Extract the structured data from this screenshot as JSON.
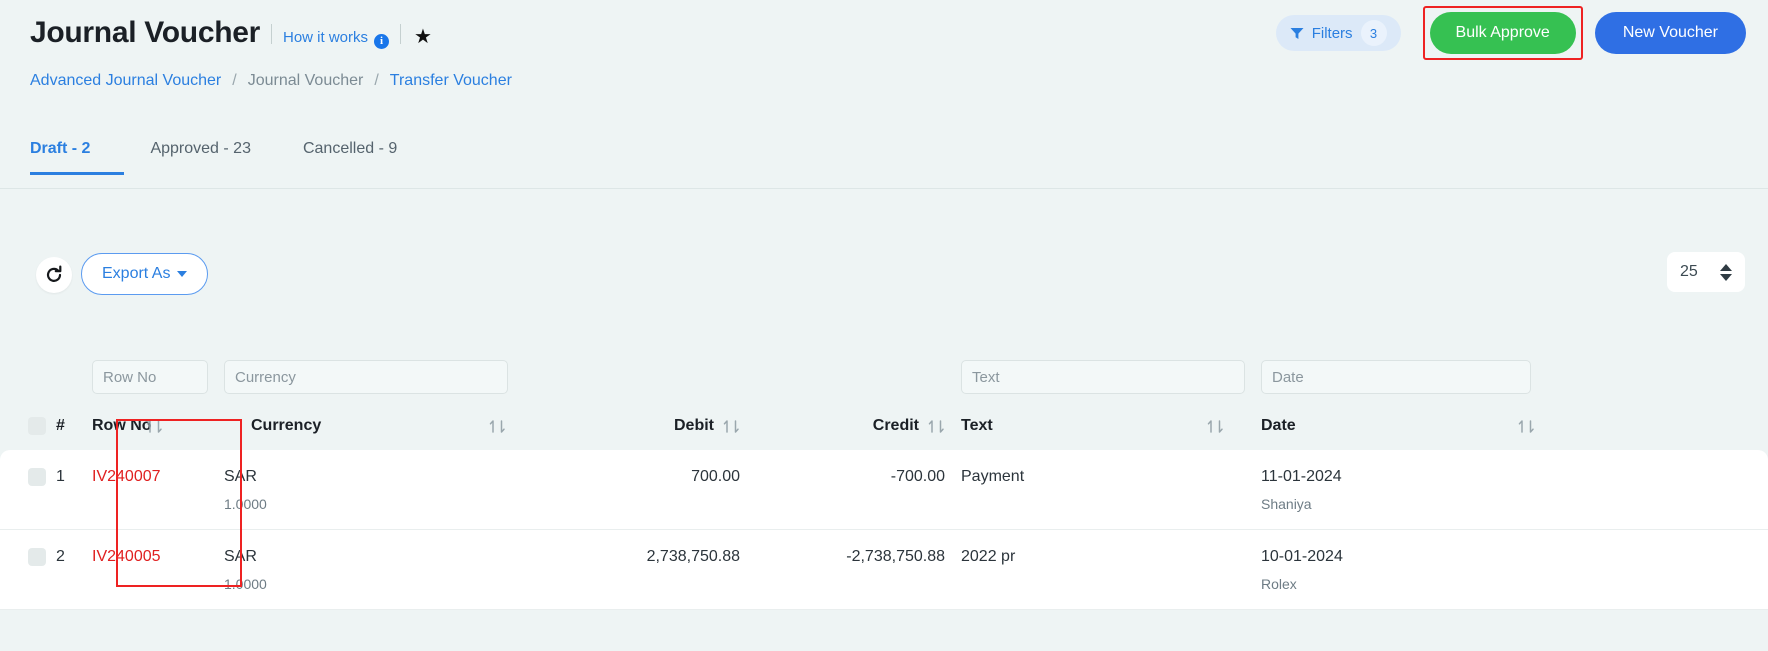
{
  "header": {
    "title": "Journal Voucher",
    "how_it_works": "How it works",
    "info_icon": "info-icon",
    "favorite_icon": "star-icon",
    "filters": {
      "label": "Filters",
      "count": "3",
      "icon": "funnel-icon"
    },
    "bulk_approve": "Bulk Approve",
    "new_voucher": "New Voucher",
    "accent_green": "#36c152",
    "accent_blue": "#2f6fe4",
    "highlight_red": "#ee2222"
  },
  "breadcrumb": {
    "items": [
      {
        "label": "Advanced Journal Voucher",
        "current": false
      },
      {
        "label": "Journal Voucher",
        "current": true
      },
      {
        "label": "Transfer Voucher",
        "current": false
      }
    ],
    "separator": "/"
  },
  "tabs": [
    {
      "label": "Draft - 2",
      "active": true
    },
    {
      "label": "Approved - 23",
      "active": false
    },
    {
      "label": "Cancelled - 9",
      "active": false
    }
  ],
  "toolbar": {
    "refresh_icon": "refresh-icon",
    "export_label": "Export As",
    "page_size": "25"
  },
  "table": {
    "filters": [
      {
        "placeholder": "Row No",
        "value": "",
        "name": "filter-row-no"
      },
      {
        "placeholder": "Currency",
        "value": "",
        "name": "filter-currency"
      },
      {
        "placeholder": "Text",
        "value": "",
        "name": "filter-text"
      },
      {
        "placeholder": "Date",
        "value": "",
        "name": "filter-date"
      }
    ],
    "columns": {
      "index": "#",
      "row_no": "Row No",
      "currency": "Currency",
      "debit": "Debit",
      "credit": "Credit",
      "text": "Text",
      "date": "Date"
    },
    "rows": [
      {
        "index": "1",
        "row_no": "IV240007",
        "currency": "SAR",
        "rate": "1.0000",
        "debit": "700.00",
        "credit": "-700.00",
        "text": "Payment",
        "date": "11-01-2024",
        "user": "Shaniya"
      },
      {
        "index": "2",
        "row_no": "IV240005",
        "currency": "SAR",
        "rate": "1.0000",
        "debit": "2,738,750.88",
        "credit": "-2,738,750.88",
        "text": "2022 pr",
        "date": "10-01-2024",
        "user": "Rolex"
      }
    ]
  }
}
